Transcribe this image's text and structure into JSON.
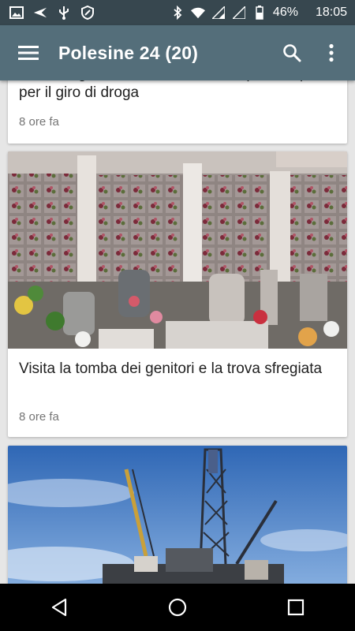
{
  "status_bar": {
    "battery_percent": "46%",
    "time": "18:05",
    "icons": [
      "image-icon",
      "send-icon",
      "usb-icon",
      "shield-icon",
      "bluetooth-icon",
      "wifi-icon",
      "signal-icon",
      "signal-icon",
      "battery-icon"
    ]
  },
  "app_bar": {
    "title": "Polesine 24 (20)",
    "menu_icon": "hamburger-icon",
    "search_icon": "search-icon",
    "overflow_icon": "more-vert-icon",
    "background": "#546e7a"
  },
  "feed": {
    "articles": [
      {
        "title": "Una siringa davanti casa, cittadini preoccupati per il giro di droga",
        "time": "8 ore fa"
      },
      {
        "title": "Visita la tomba dei genitori e la trova sfregiata",
        "time": "8 ore fa"
      },
      {
        "title": "",
        "time": ""
      }
    ]
  },
  "nav_bar": {
    "back_icon": "back-triangle-icon",
    "home_icon": "home-circle-icon",
    "recents_icon": "recents-square-icon"
  }
}
